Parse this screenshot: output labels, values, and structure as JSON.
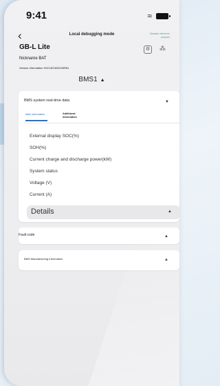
{
  "status": {
    "time": "9:41",
    "wifi_icon": "wifi-icon",
    "battery_icon": "battery-icon"
  },
  "nav": {
    "back_icon": "back-arrow-icon",
    "title": "Local debugging mode",
    "link": "Maintain reference program"
  },
  "device": {
    "name": "GB-L Lite",
    "nickname": "Nickname BAT",
    "version": "Version Information HVCUE1625103R61"
  },
  "selector": {
    "label": "BMS1"
  },
  "realtime": {
    "title": "BMS system real-time data",
    "tabs": [
      {
        "label": "Main information"
      },
      {
        "label": "Additional information"
      }
    ],
    "fields": [
      {
        "label": "External display SOC(%)"
      },
      {
        "label": "SOH(%)"
      },
      {
        "label": "Current charge and discharge power(kW)"
      },
      {
        "label": "System status"
      },
      {
        "label": "Voltage (V)"
      },
      {
        "label": "Current (A)"
      }
    ],
    "details_label": "Details"
  },
  "fault": {
    "label": "Fault code"
  },
  "manufacturing": {
    "label": "BMS Manufacturing Information"
  },
  "colors": {
    "accent": "#2f6fb8",
    "link": "#5aa16e",
    "background": "#eeeef0"
  }
}
